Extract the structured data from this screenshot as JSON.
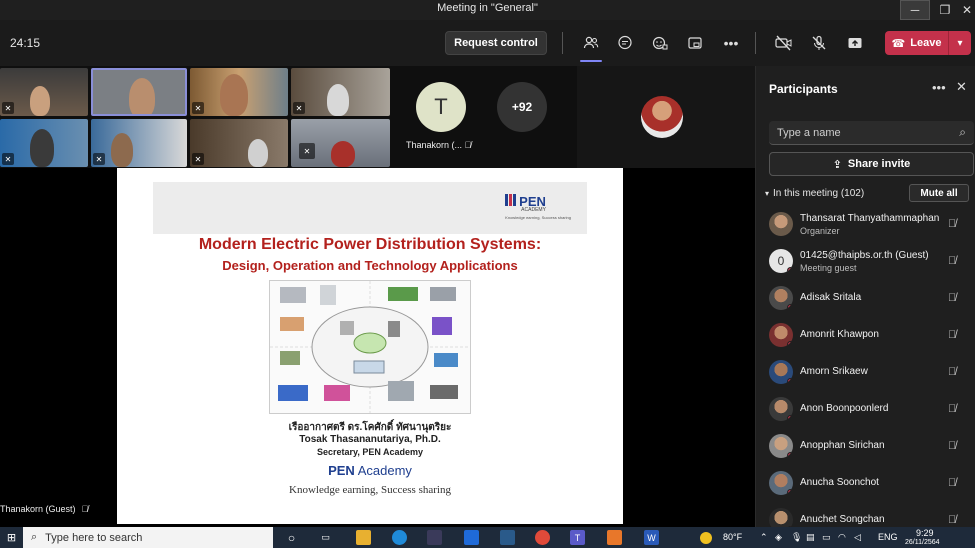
{
  "window": {
    "title": "Meeting in \"General\""
  },
  "toolbar": {
    "timer": "24:15",
    "request_control_label": "Request control",
    "leave_label": "Leave"
  },
  "gallery": {
    "avatar_letter": "T",
    "avatar_name": "Thanakorn (...",
    "overflow_count": "+92"
  },
  "presenter": {
    "name": "Thanakorn (Guest)"
  },
  "slide": {
    "logo_text": "PEN",
    "logo_sub": "ACADEMY",
    "logo_tagline": "Knowledge earning, Success sharing",
    "title_line1": "Modern Electric Power Distribution Systems:",
    "title_line2": "Design, Operation and Technology Applications",
    "author_thai": "เรืออากาศตรี ดร.โคศักดิ์ ทัศนานุตริยะ",
    "author_en": "Tosak Thasananutariya, Ph.D.",
    "role": "Secretary, PEN Academy",
    "org_bold": "PEN",
    "org_rest": " Academy",
    "tagline": "Knowledge earning, Success sharing"
  },
  "panel": {
    "title": "Participants",
    "search_placeholder": "Type a name",
    "share_invite_label": "Share invite",
    "in_meeting_label": "In this meeting (102)",
    "mute_all_label": "Mute all",
    "participants": [
      {
        "name": "Thansarat Thanyathammaphan",
        "role": "Organizer"
      },
      {
        "name": "01425@thaipbs.or.th (Guest)",
        "role": "Meeting guest",
        "initial": "0"
      },
      {
        "name": "Adisak Sritala",
        "role": ""
      },
      {
        "name": "Amonrit Khawpon",
        "role": ""
      },
      {
        "name": "Amorn Srikaew",
        "role": ""
      },
      {
        "name": "Anon Boonpoonlerd",
        "role": ""
      },
      {
        "name": "Anopphan Sirichan",
        "role": ""
      },
      {
        "name": "Anucha Soonchot",
        "role": ""
      },
      {
        "name": "Anuchet Songchan",
        "role": ""
      }
    ]
  },
  "taskbar": {
    "search_placeholder": "Type here to search",
    "weather": "80°F",
    "language": "ENG",
    "time": "9:29",
    "date": "26/11/2564"
  },
  "colors": {
    "leave": "#c4314b",
    "accent": "#7f85f5",
    "slide_title": "#b3211d",
    "pen_blue": "#1f3f8f"
  }
}
